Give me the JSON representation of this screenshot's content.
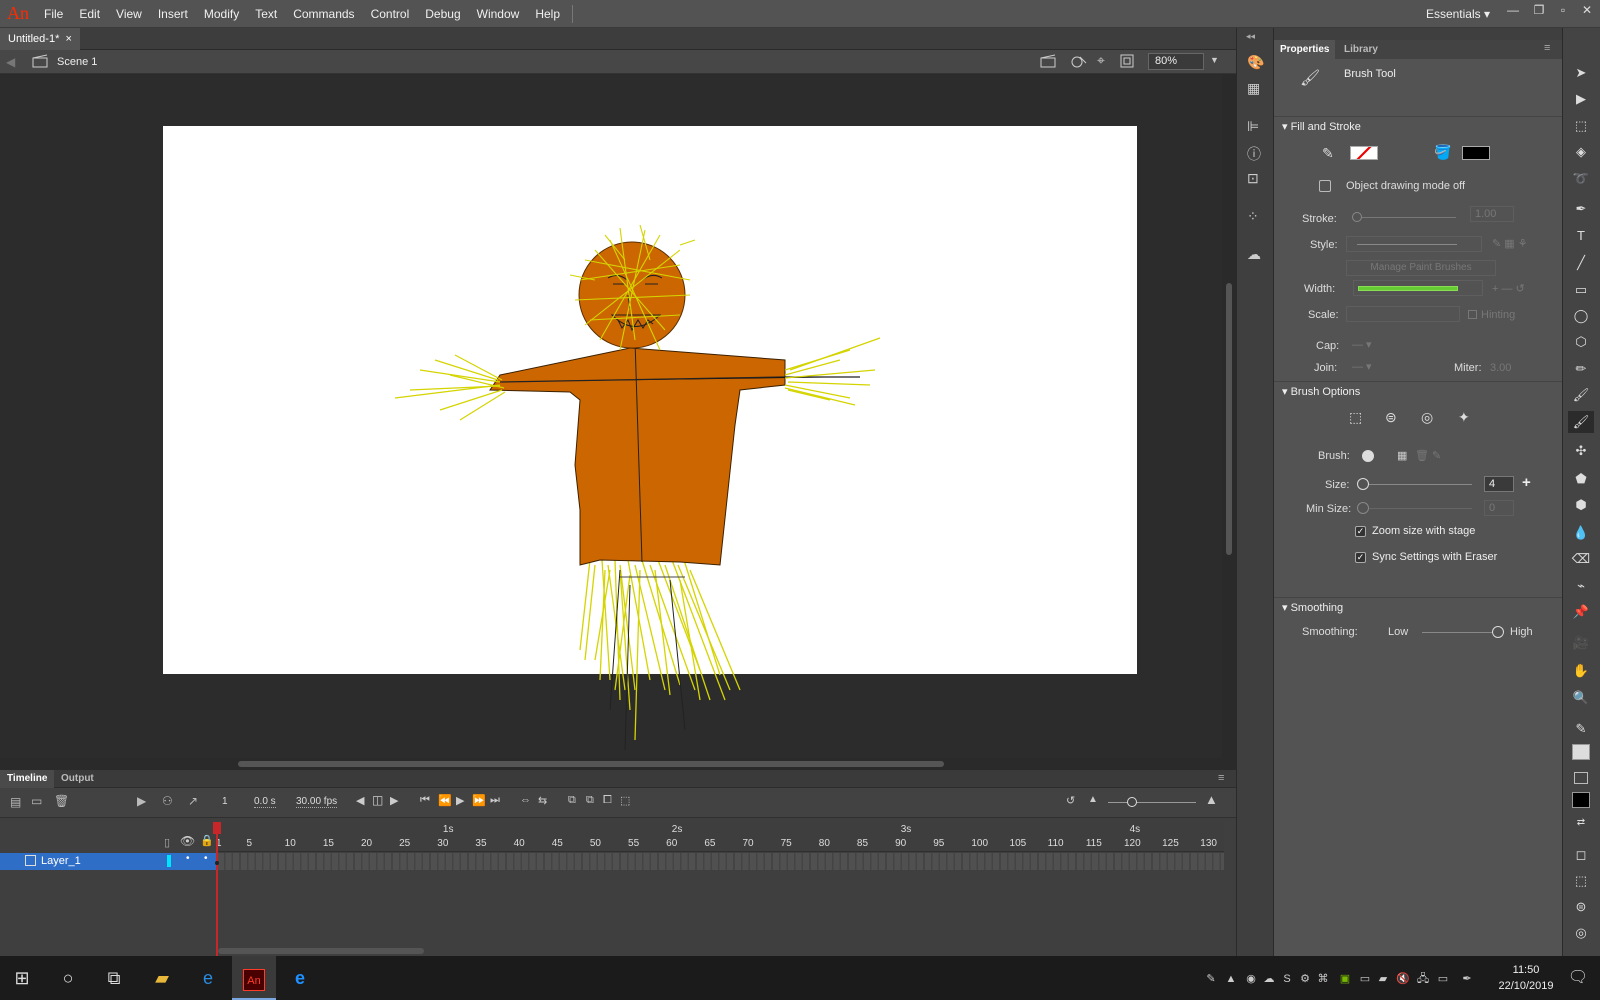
{
  "app": {
    "logo": "An",
    "menus": [
      "File",
      "Edit",
      "View",
      "Insert",
      "Modify",
      "Text",
      "Commands",
      "Control",
      "Debug",
      "Window",
      "Help"
    ],
    "workspace": "Essentials",
    "window_buttons": [
      "—",
      "❐",
      "▫",
      "✕"
    ]
  },
  "document": {
    "tab_title": "Untitled-1*",
    "close": "×",
    "scene": "Scene 1",
    "zoom": "80%"
  },
  "timeline": {
    "tabs": [
      "Timeline",
      "Output"
    ],
    "current_frame": "1",
    "time": "0.0 s",
    "fps": "30.00 fps",
    "layer_name": "Layer_1",
    "second_marks": [
      "1s",
      "2s",
      "3s",
      "4s"
    ],
    "frame_ticks": [
      "1",
      "5",
      "10",
      "15",
      "20",
      "25",
      "30",
      "35",
      "40",
      "45",
      "50",
      "55",
      "60",
      "65",
      "70",
      "75",
      "80",
      "85",
      "90",
      "95",
      "100",
      "105",
      "110",
      "115",
      "120",
      "125",
      "130"
    ]
  },
  "properties": {
    "tabs": [
      "Properties",
      "Library"
    ],
    "tool_name": "Brush Tool",
    "fill_stroke": {
      "title": "Fill and Stroke",
      "object_drawing": "Object drawing mode off",
      "stroke_label": "Stroke:",
      "stroke_value": "1.00",
      "style_label": "Style:",
      "manage_brushes": "Manage Paint Brushes",
      "width_label": "Width:",
      "scale_label": "Scale:",
      "hinting": "Hinting",
      "cap_label": "Cap:",
      "join_label": "Join:",
      "miter_label": "Miter:",
      "miter_value": "3.00",
      "fill_color": "#000000"
    },
    "brush_options": {
      "title": "Brush Options",
      "brush_label": "Brush:",
      "size_label": "Size:",
      "size_value": "4",
      "min_size_label": "Min Size:",
      "min_size_value": "0",
      "zoom_with_stage": "Zoom size with stage",
      "sync_eraser": "Sync Settings with Eraser"
    },
    "smoothing": {
      "title": "Smoothing",
      "label": "Smoothing:",
      "low": "Low",
      "high": "High",
      "level": 1.0
    }
  },
  "taskbar": {
    "time": "11:50",
    "date": "22/10/2019",
    "animate_icon_text": "An"
  },
  "colors": {
    "accent": "#2f6ec7",
    "shirt": "#cc6600",
    "straw": "#d4d400",
    "playhead": "#c8272a"
  }
}
